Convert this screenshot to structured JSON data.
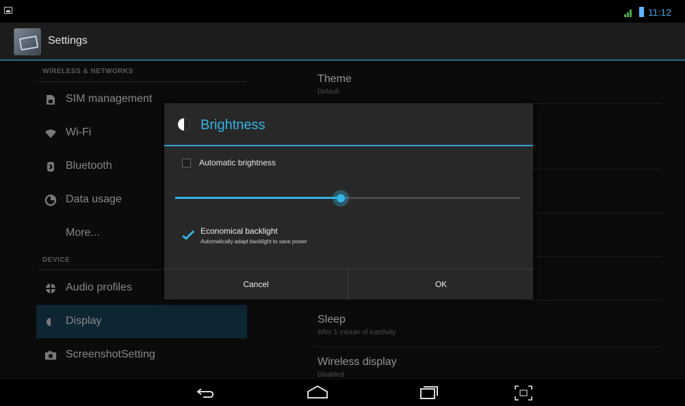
{
  "status_bar": {
    "time": "11:12",
    "notification_icon": "picture-icon",
    "signal_icon": "signal-icon",
    "battery_icon": "battery-icon",
    "accent_color": "#4aa7e8"
  },
  "action_bar": {
    "title": "Settings",
    "icon": "settings-app-icon"
  },
  "sidebar": {
    "section_wireless": "WIRELESS & NETWORKS",
    "section_device": "DEVICE",
    "items": [
      {
        "label": "SIM management",
        "icon": "sim-icon"
      },
      {
        "label": "Wi-Fi",
        "icon": "wifi-icon"
      },
      {
        "label": "Bluetooth",
        "icon": "bluetooth-icon"
      },
      {
        "label": "Data usage",
        "icon": "data-usage-icon"
      },
      {
        "label": "More...",
        "icon": ""
      },
      {
        "label": "Audio profiles",
        "icon": "audio-profiles-icon"
      },
      {
        "label": "Display",
        "icon": "display-icon",
        "active": true
      },
      {
        "label": "ScreenshotSetting",
        "icon": "screenshot-icon"
      }
    ]
  },
  "display_settings": {
    "theme_title": "Theme",
    "theme_summary": "Default",
    "sleep_title": "Sleep",
    "sleep_summary": "After 1 minute of inactivity",
    "wireless_display_title": "Wireless display",
    "wireless_display_summary": "Disabled"
  },
  "dialog": {
    "title": "Brightness",
    "icon": "brightness-icon",
    "automatic_label": "Automatic brightness",
    "automatic_checked": false,
    "brightness_level": 0.48,
    "eco_title": "Economical backlight",
    "eco_summary": "Automatically adapt backlight to save power",
    "eco_checked": true,
    "cancel_label": "Cancel",
    "ok_label": "OK",
    "accent_color": "#33b5e5"
  },
  "nav_bar": {
    "back_icon": "back-icon",
    "home_icon": "home-icon",
    "recents_icon": "recents-icon",
    "screenshot_icon": "screenshot-capture-icon"
  }
}
